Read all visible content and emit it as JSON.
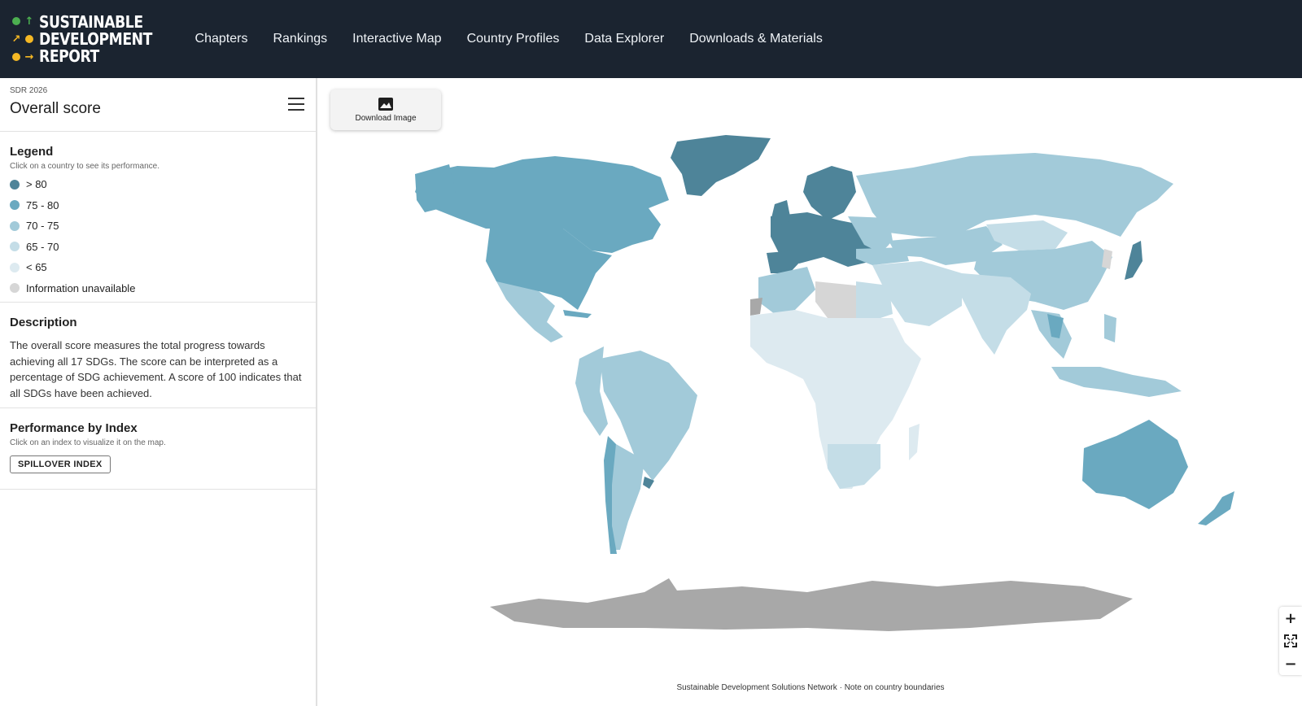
{
  "brand": {
    "lines": [
      "SUSTAINABLE",
      "DEVELOPMENT",
      "REPORT"
    ],
    "mark_colors": [
      "#4caf50",
      "#f5b824",
      "#e8452c"
    ]
  },
  "nav": [
    "Chapters",
    "Rankings",
    "Interactive Map",
    "Country Profiles",
    "Data Explorer",
    "Downloads & Materials"
  ],
  "sidebar": {
    "eyebrow": "SDR 2026",
    "title": "Overall score",
    "legend": {
      "heading": "Legend",
      "hint": "Click on a country to see its performance.",
      "items": [
        {
          "label": "> 80",
          "color": "#4e8499"
        },
        {
          "label": "75 - 80",
          "color": "#6aa9c0"
        },
        {
          "label": "70 - 75",
          "color": "#a2cad9"
        },
        {
          "label": "65 - 70",
          "color": "#c4dde7"
        },
        {
          "label": "< 65",
          "color": "#ddeaf0"
        },
        {
          "label": "Information unavailable",
          "color": "#d6d6d6"
        }
      ]
    },
    "description": {
      "heading": "Description",
      "text": "The overall score measures the total progress towards achieving all 17 SDGs. The score can be interpreted as a percentage of SDG achievement. A score of 100 indicates that all SDGs have been achieved."
    },
    "performance": {
      "heading": "Performance by Index",
      "hint": "Click on an index to visualize it on the map.",
      "button": "SPILLOVER INDEX"
    }
  },
  "map": {
    "download_label": "Download Image",
    "zoom_in": "+",
    "zoom_out": "−",
    "credits_left": "Sustainable Development Solutions Network",
    "credits_sep": "·",
    "credits_right": "Note on country boundaries"
  }
}
